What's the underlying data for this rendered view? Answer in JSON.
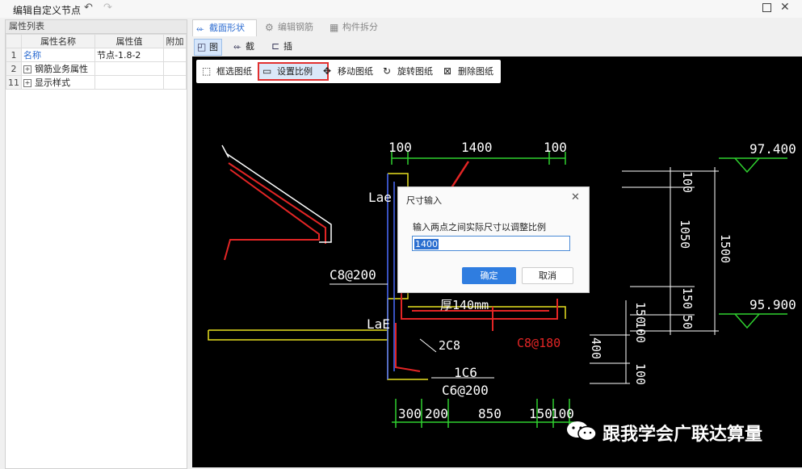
{
  "titlebar": {
    "title": "编辑自定义节点"
  },
  "left_panel": {
    "header": "属性列表",
    "columns": [
      "属性名称",
      "属性值",
      "附加"
    ],
    "rows": [
      {
        "num": "1",
        "name": "名称",
        "value": "节点-1.8-2"
      },
      {
        "num": "2",
        "name": "钢筋业务属性",
        "value": ""
      },
      {
        "num": "11",
        "name": "显示样式",
        "value": ""
      }
    ]
  },
  "tabs": [
    {
      "label": "截面形状",
      "icon": "section-shape-icon"
    },
    {
      "label": "编辑钢筋",
      "icon": "edit-rebar-icon"
    },
    {
      "label": "构件拆分",
      "icon": "split-component-icon"
    }
  ],
  "subtools": [
    {
      "label": "图纸",
      "icon": "drawing-icon"
    },
    {
      "label": "截面",
      "icon": "section-icon"
    },
    {
      "label": "插入点",
      "icon": "insert-point-icon"
    }
  ],
  "floating_toolbar": [
    {
      "label": "框选图纸",
      "icon": "box-select-icon"
    },
    {
      "label": "设置比例",
      "icon": "scale-icon"
    },
    {
      "label": "移动图纸",
      "icon": "move-icon"
    },
    {
      "label": "旋转图纸",
      "icon": "rotate-icon"
    },
    {
      "label": "删除图纸",
      "icon": "delete-drawing-icon"
    }
  ],
  "drawing_labels": {
    "dim_100_left": "100",
    "dim_1400": "1400",
    "dim_100_right": "100",
    "elev_top": "97.400",
    "elev_mid": "95.900",
    "lae_top": "Lae",
    "lae_bottom": "LaE",
    "c8_200": "C8@200",
    "thick": "厚140mm",
    "c8_180": "C8@180",
    "two_c8": "2C8",
    "one_c6": "1C6",
    "c6_200": "C6@200",
    "v100a": "100",
    "v1050": "1050",
    "v150a": "150",
    "v50": "50",
    "v1500": "1500",
    "v150b": "150",
    "v100b": "100",
    "v400": "400",
    "v100c": "100",
    "b300": "300",
    "b200": "200",
    "b850": "850",
    "b150": "150",
    "b100": "100"
  },
  "dialog": {
    "title": "尺寸输入",
    "label": "输入两点之间实际尺寸以调整比例",
    "value": "1400",
    "ok": "确定",
    "cancel": "取消"
  },
  "watermark": "跟我学会广联达算量"
}
